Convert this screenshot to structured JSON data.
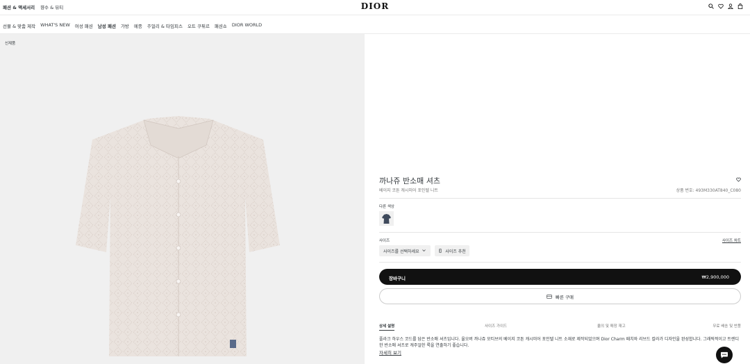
{
  "header": {
    "top_nav": [
      "패션 & 액세서리",
      "향수 & 뷰티"
    ],
    "logo": "DIOR",
    "icons": [
      "search-icon",
      "heart-icon",
      "user-icon",
      "bag-icon"
    ]
  },
  "category_nav": [
    "선물 & 맞춤 제작",
    "WHAT'S NEW",
    "여성 패션",
    "남성 패션",
    "가방",
    "메종",
    "주얼리 & 타임피스",
    "오트 쿠튀르",
    "패션쇼",
    "DIOR WORLD"
  ],
  "image_pane": {
    "new_tag": "신제품"
  },
  "product": {
    "title": "까나쥬 반소매 셔츠",
    "subtitle": "베이지 코튼 캐시미어 포인텔 니트",
    "reference": "상품 번호: 493M330AT840_C080",
    "other_colors_label": "다른 색상",
    "size_label": "사이즈",
    "size_chart_label": "사이즈 차트",
    "size_select_placeholder": "사이즈를 선택하세요",
    "size_recommend_label": "사이즈 추천",
    "add_to_cart_label": "장바구니",
    "price": "₩2,900,000",
    "quick_buy_label": "빠른 구매",
    "tabs": [
      "상세 설명",
      "사이즈 가이드",
      "옮의 및 매장 재고",
      "무료 배송 및 반품"
    ],
    "description": "플라크 하우스 코드를 담은 반소매 셔츠입니다. 울오버 까나쥬 모티브의 베이지 코튼 캐시미어 포인텔 니트 소재로 제작되었으며 Dior Charm 패치와 리브드 칼라가 디자인을 완성합니다. 그래픽적이고 트렌디한 반소매 셔츠로 캐주얼한 룩을 연출하기 좋습니다.",
    "read_more_label": "자세히 보기"
  },
  "colors": {
    "accent": "#111111",
    "shirt": "#eae3de",
    "background": "#f0f0f0"
  }
}
